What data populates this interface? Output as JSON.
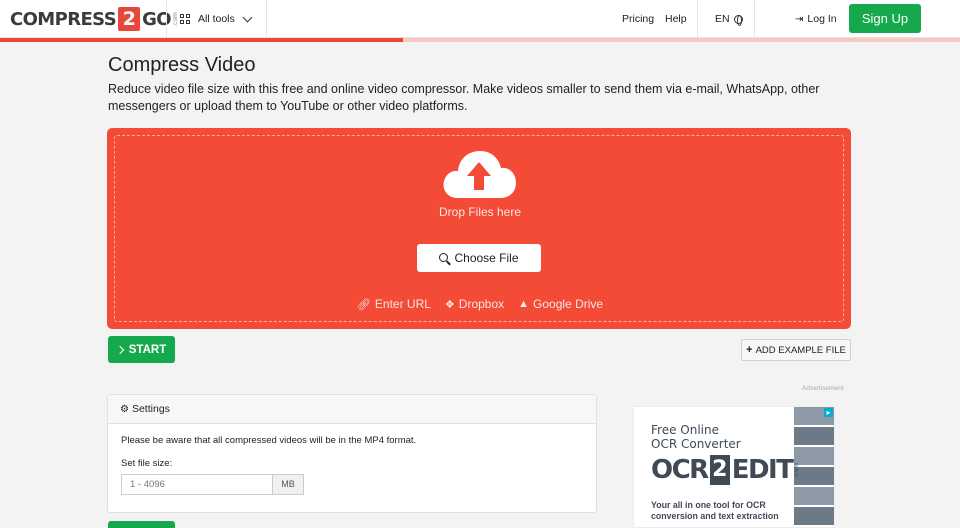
{
  "header": {
    "logo": {
      "left": "COMPRESS",
      "two": "2",
      "right": "GO",
      "suffix": ".com"
    },
    "all_tools": "All tools",
    "pricing": "Pricing",
    "help": "Help",
    "language": "EN",
    "login": "Log In",
    "signup": "Sign Up",
    "progress": 0.42,
    "colors": {
      "brand_red": "#e9463a",
      "green": "#16a84d"
    }
  },
  "main": {
    "title": "Compress Video",
    "description": "Reduce video file size with this free and online video compressor. Make videos smaller to send them via e-mail, WhatsApp, other messengers or upload them to YouTube or other video platforms."
  },
  "dropzone": {
    "drop_text": "Drop Files here",
    "choose_file": "Choose File",
    "sources": [
      {
        "icon": "link-icon",
        "label": "Enter URL"
      },
      {
        "icon": "dropbox-icon",
        "label": "Dropbox"
      },
      {
        "icon": "google-drive-icon",
        "label": "Google Drive"
      }
    ],
    "color": "#f44b36"
  },
  "actions": {
    "start": "START",
    "add_example": "ADD EXAMPLE FILE"
  },
  "settings": {
    "header": "Settings",
    "note": "Please be aware that all compressed videos will be in the MP4 format.",
    "file_size_label": "Set file size:",
    "file_size_placeholder": "1 - 4096",
    "file_size_unit": "MB"
  },
  "ad": {
    "label": "Advertisement",
    "title": "Free Online\nOCR Converter",
    "logo_left": "OCR",
    "logo_two": "2",
    "logo_right": "EDIT",
    "logo_suffix": ".com",
    "subtitle": "Your all in one tool for OCR\nconversion and text extraction"
  }
}
